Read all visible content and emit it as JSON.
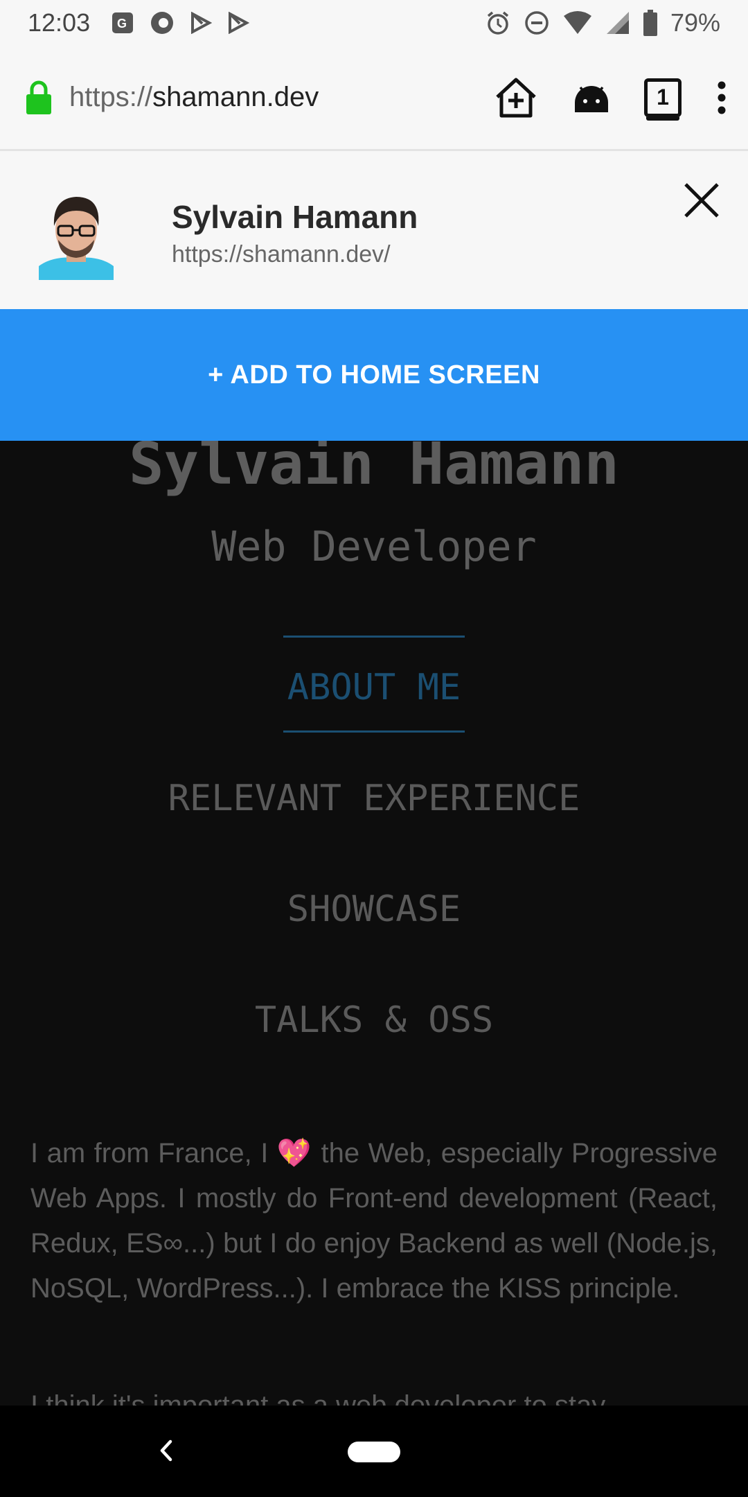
{
  "status_bar": {
    "time": "12:03",
    "battery": "79%",
    "icons": [
      "maps-icon",
      "firefox-icon",
      "play-store-icon",
      "play-store-icon",
      "alarm-icon",
      "do-not-disturb-icon",
      "wifi-icon",
      "signal-icon",
      "battery-icon"
    ]
  },
  "browser": {
    "url_scheme": "https://",
    "url_host": "shamann.dev",
    "tab_count": "1"
  },
  "banner": {
    "title": "Sylvain Hamann",
    "url": "https://shamann.dev/",
    "add_button": "+ ADD TO HOME SCREEN"
  },
  "page": {
    "name": "Sylvain Hamann",
    "role": "Web Developer",
    "nav": [
      "ABOUT ME",
      "RELEVANT EXPERIENCE",
      "SHOWCASE",
      "TALKS & OSS"
    ],
    "paragraph1_before": "I am from France, I ",
    "paragraph1_emoji": "💖",
    "paragraph1_after": " the Web, especially Progressive Web Apps. I mostly do Front-end development (React, Redux, ES∞...) but I do enjoy Backend as well (Node.js, NoSQL, WordPress...). I embrace the KISS principle.",
    "paragraph2": "I think it's important as a web developer to stay"
  },
  "colors": {
    "accent": "#2791f3",
    "lock": "#1ec31e",
    "nav_active": "#1b4f72"
  }
}
